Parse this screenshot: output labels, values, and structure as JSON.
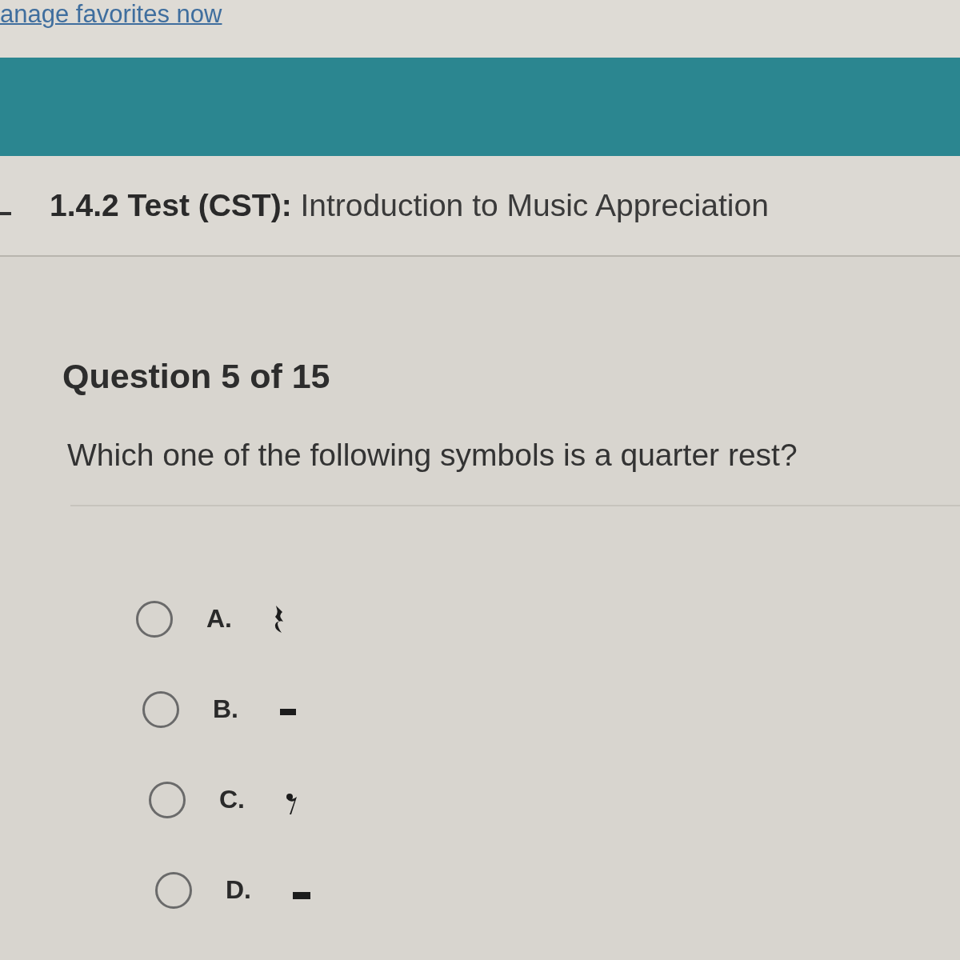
{
  "top_bar": {
    "link": "anage favorites now"
  },
  "header": {
    "title": "**1.4.2 Test (CST):** Introduction to Music Appreciation"
  },
  "question": {
    "heading": "Question 5 of 15",
    "prompt": "Which one of the following symbols is a quarter rest?"
  },
  "options": [
    {
      "letter": "A.",
      "kind": "quarter-rest",
      "selected": false
    },
    {
      "letter": "B.",
      "kind": "half-rest",
      "selected": false
    },
    {
      "letter": "C.",
      "kind": "eighth-rest",
      "selected": false
    },
    {
      "letter": "D.",
      "kind": "whole-rest",
      "selected": false
    }
  ]
}
